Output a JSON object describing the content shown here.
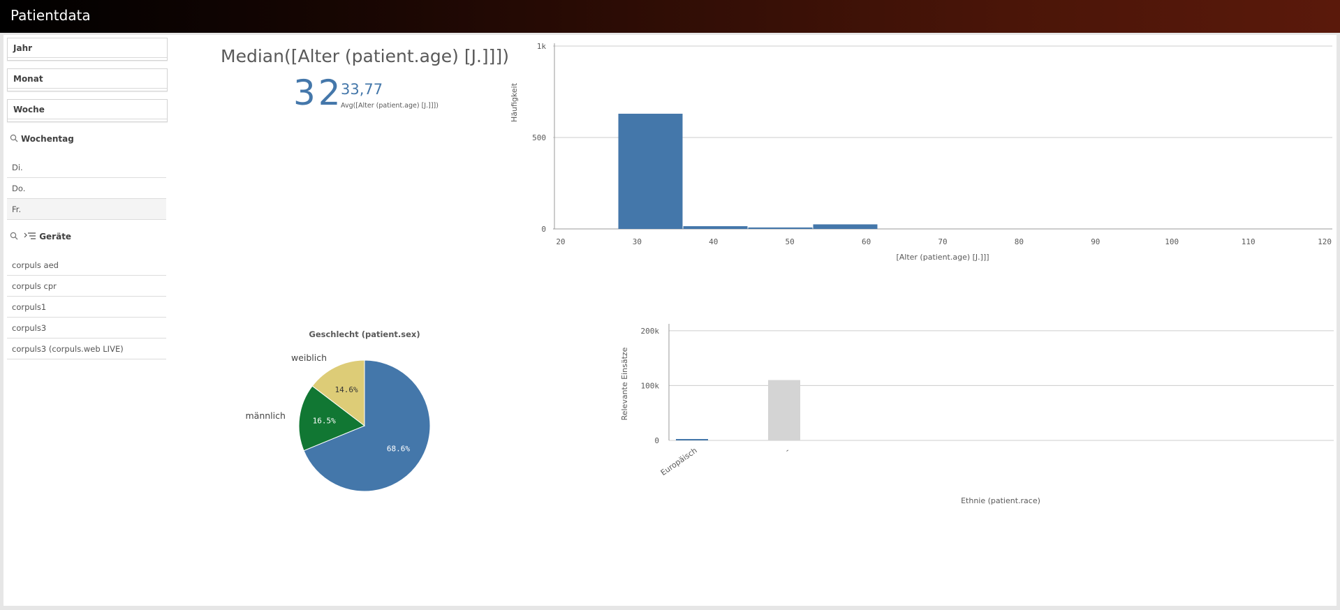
{
  "app": {
    "title": "Patientdata"
  },
  "sidebar": {
    "filters": [
      {
        "label": "Jahr"
      },
      {
        "label": "Monat"
      },
      {
        "label": "Woche"
      }
    ],
    "wochentag": {
      "title": "Wochentag",
      "items": [
        "Di.",
        "Do.",
        "Fr."
      ]
    },
    "geraete": {
      "title": "Geräte",
      "items": [
        "corpuls aed",
        "corpuls cpr",
        "corpuls1",
        "corpuls3",
        "corpuls3 (corpuls.web LIVE)"
      ]
    }
  },
  "kpi": {
    "title": "Median([Alter (patient.age) [J.]]])",
    "main_value": "32",
    "secondary_value": "33,77",
    "secondary_label": "Avg([Alter (patient.age) [J.]]])"
  },
  "colors": {
    "blue": "#4477aa",
    "green": "#117733",
    "yellow": "#ddcc77",
    "grey": "#d4d4d4",
    "grid": "#cccccc"
  },
  "chart_data": [
    {
      "type": "bar",
      "chart": "histogram",
      "xlabel": "[Alter (patient.age) [J.]]]",
      "ylabel": "Häufigkeit",
      "xlim": [
        19,
        121
      ],
      "ylim": [
        0,
        1000
      ],
      "x_ticks": [
        "20",
        "30",
        "40",
        "50",
        "60",
        "70",
        "80",
        "90",
        "100",
        "110",
        "120"
      ],
      "y_ticks": [
        "0",
        "500",
        "1k"
      ],
      "bins": [
        {
          "from": 27.5,
          "to": 36,
          "value": 630
        },
        {
          "from": 36,
          "to": 44.5,
          "value": 15
        },
        {
          "from": 44.5,
          "to": 53,
          "value": 8
        },
        {
          "from": 53,
          "to": 61.5,
          "value": 25
        }
      ],
      "grid": true
    },
    {
      "type": "pie",
      "title": "Geschlecht (patient.sex)",
      "slices": [
        {
          "label": "",
          "value": 68.6,
          "value_label": "68.6%",
          "color": "#4477aa"
        },
        {
          "label": "männlich",
          "value": 16.5,
          "value_label": "16.5%",
          "color": "#117733"
        },
        {
          "label": "weiblich",
          "value": 14.6,
          "value_label": "14.6%",
          "color": "#ddcc77"
        }
      ]
    },
    {
      "type": "bar",
      "xlabel": "Ethnie (patient.race)",
      "ylabel": "Relevante Einsätze",
      "categories": [
        "Europäisch",
        "-"
      ],
      "values": [
        2000,
        110000
      ],
      "colors": [
        "#4477aa",
        "#d4d4d4"
      ],
      "ylim": [
        0,
        210000
      ],
      "y_ticks": [
        "0",
        "100k",
        "200k"
      ],
      "grid": true
    }
  ]
}
